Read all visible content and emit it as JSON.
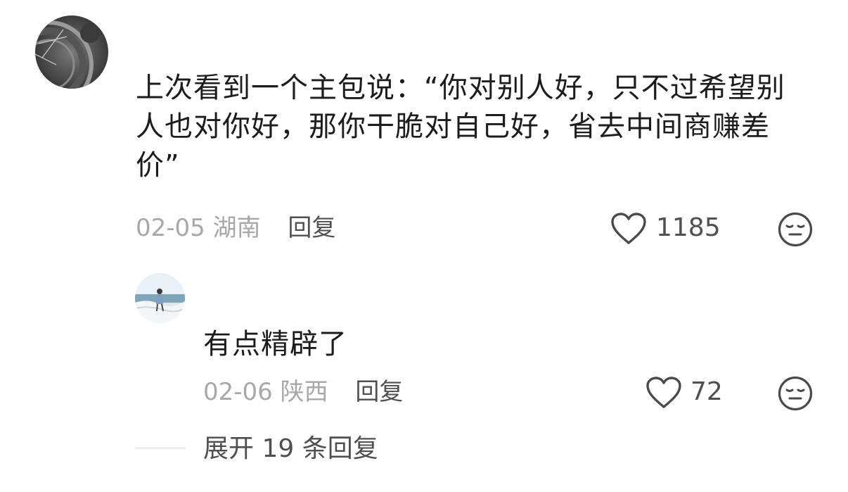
{
  "main_comment": {
    "text": "上次看到一个主包说：“你对别人好，只不过希望别人也对你好，那你干脆对自己好，省去中间商赚差价”",
    "date": "02-05",
    "location": "湖南",
    "reply_label": "回复",
    "like_count": "1185"
  },
  "reply_comment": {
    "text": "有点精辟了",
    "date": "02-06",
    "location": "陕西",
    "reply_label": "回复",
    "like_count": "72"
  },
  "expand": {
    "label": "展开 19 条回复"
  },
  "icons": {
    "like": "heart-outline-icon",
    "reaction": "meh-face-icon"
  },
  "colors": {
    "text": "#1c1c1c",
    "meta": "#a8a8a8",
    "secondary": "#505050"
  }
}
